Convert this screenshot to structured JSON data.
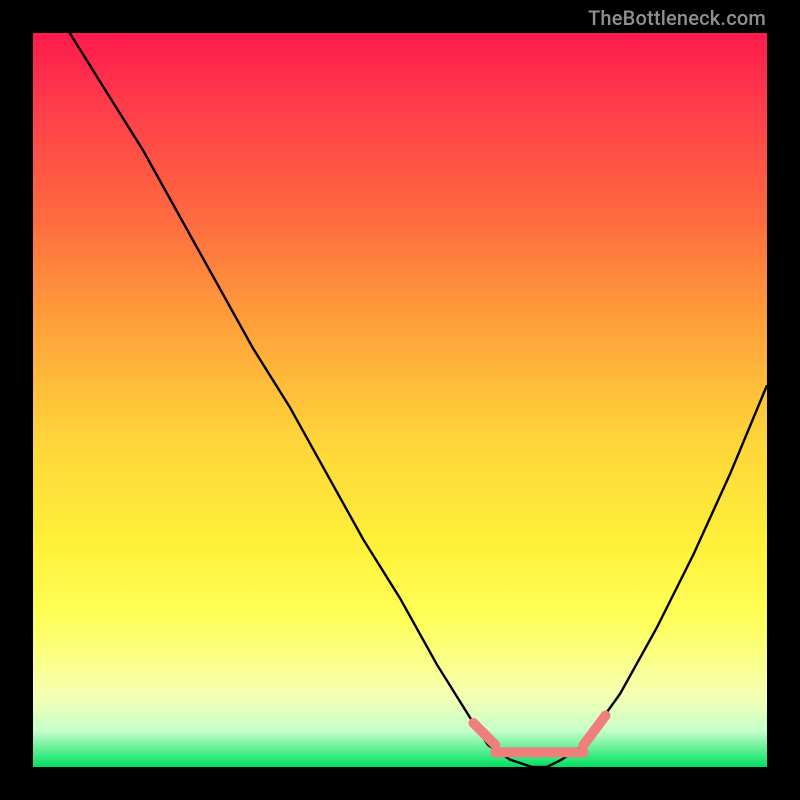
{
  "watermark": "TheBottleneck.com",
  "colors": {
    "frame": "#000000",
    "curve": "#000000",
    "highlight": "#ef7f7d",
    "gradient_stops": [
      "#ff1a4d",
      "#ff3c4a",
      "#ff6a3f",
      "#ffa23a",
      "#ffd33a",
      "#fff13a",
      "#ffff5a",
      "#f6ffb0",
      "#c8ffcc",
      "#00e060"
    ]
  },
  "chart_data": {
    "type": "line",
    "title": "",
    "xlabel": "",
    "ylabel": "",
    "xlim": [
      0,
      100
    ],
    "ylim": [
      0,
      100
    ],
    "grid": false,
    "legend": false,
    "annotations": [],
    "series": [
      {
        "name": "bottleneck-curve",
        "x": [
          5,
          10,
          15,
          20,
          25,
          30,
          35,
          40,
          45,
          50,
          55,
          60,
          62,
          65,
          68,
          70,
          72,
          75,
          80,
          85,
          90,
          95,
          100
        ],
        "values": [
          100,
          92,
          84,
          75,
          66,
          57,
          49,
          40,
          31,
          23,
          14,
          6,
          3,
          1,
          0,
          0,
          1,
          3,
          10,
          19,
          29,
          40,
          52
        ]
      }
    ],
    "highlight_segments": [
      {
        "name": "left-knee",
        "x": [
          60,
          63
        ],
        "values": [
          6,
          3
        ]
      },
      {
        "name": "valley-floor",
        "x": [
          63,
          75
        ],
        "values": [
          2,
          2
        ]
      },
      {
        "name": "right-knee",
        "x": [
          75,
          78
        ],
        "values": [
          3,
          7
        ]
      }
    ]
  }
}
